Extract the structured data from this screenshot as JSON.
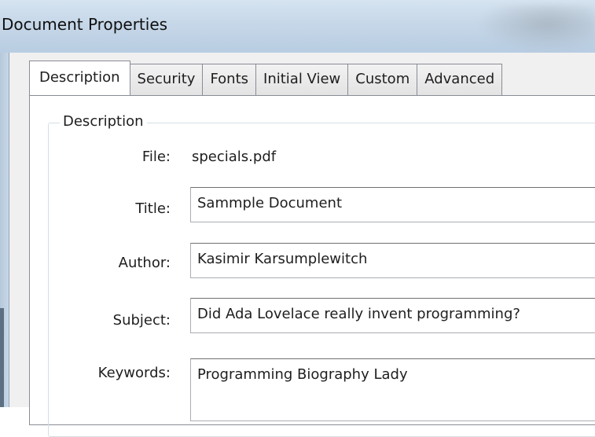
{
  "window": {
    "title": "Document Properties"
  },
  "tabs": [
    {
      "label": "Description",
      "selected": true
    },
    {
      "label": "Security",
      "selected": false
    },
    {
      "label": "Fonts",
      "selected": false
    },
    {
      "label": "Initial View",
      "selected": false
    },
    {
      "label": "Custom",
      "selected": false
    },
    {
      "label": "Advanced",
      "selected": false
    }
  ],
  "description_group": {
    "legend": "Description",
    "file": {
      "label": "File:",
      "value": "specials.pdf"
    },
    "title": {
      "label": "Title:",
      "value": "Sammple Document"
    },
    "author": {
      "label": "Author:",
      "value": "Kasimir Karsumplewitch"
    },
    "subject": {
      "label": "Subject:",
      "value": "Did Ada Lovelace really invent programming?"
    },
    "keywords": {
      "label": "Keywords:",
      "value": "Programming Biography Lady"
    }
  },
  "colors": {
    "titlebar": "#c6d7e8",
    "dialog_background": "#f0f0f0",
    "panel_background": "#ffffff",
    "border": "#898c95"
  }
}
